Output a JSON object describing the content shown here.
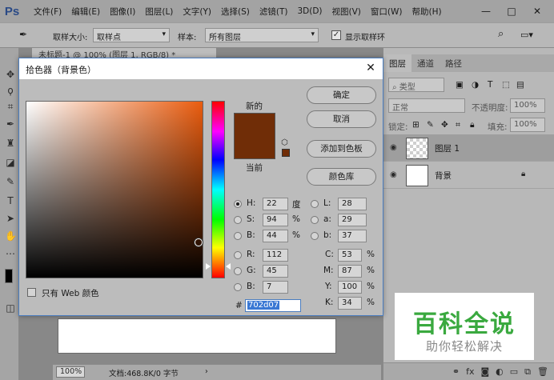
{
  "app": {
    "logo": "Ps",
    "menu": [
      "文件(F)",
      "编辑(E)",
      "图像(I)",
      "图层(L)",
      "文字(Y)",
      "选择(S)",
      "滤镜(T)",
      "3D(D)",
      "视图(V)",
      "窗口(W)",
      "帮助(H)"
    ],
    "window_controls": [
      "—",
      "□",
      "✕"
    ]
  },
  "options": {
    "sample_size_label": "取样大小:",
    "sample_size_value": "取样点",
    "sample_label": "样本:",
    "sample_value": "所有图层",
    "show_ring_label": "显示取样环",
    "show_ring_checked": true
  },
  "document": {
    "tab_title": "未标题-1 @ 100% (图层 1, RGB/8) *",
    "zoom": "100%",
    "info": "文档:468.8K/0 字节"
  },
  "layers_panel": {
    "tabs": [
      "图层",
      "通道",
      "路径"
    ],
    "filter_placeholder": "类型",
    "blend_mode": "正常",
    "opacity_label": "不透明度:",
    "opacity_value": "100%",
    "lock_label": "锁定:",
    "fill_label": "填充:",
    "fill_value": "100%",
    "layers": [
      {
        "name": "图层 1",
        "selected": true
      },
      {
        "name": "背景",
        "selected": false,
        "locked": true
      }
    ],
    "bottom_icons": [
      "link-icon",
      "fx-icon",
      "mask-icon",
      "adjustment-icon",
      "group-icon",
      "new-layer-icon",
      "trash-icon"
    ]
  },
  "watermark": {
    "line1": "百科全说",
    "line2": "助你轻松解决"
  },
  "color_picker": {
    "title": "拾色器（背景色）",
    "new_label": "新的",
    "current_label": "当前",
    "current_color": "#702d07",
    "buttons": {
      "ok": "确定",
      "cancel": "取消",
      "add_swatch": "添加到色板",
      "color_libraries": "颜色库"
    },
    "hsb": {
      "h": {
        "label": "H:",
        "value": "22",
        "unit": "度"
      },
      "s": {
        "label": "S:",
        "value": "94",
        "unit": "%"
      },
      "b": {
        "label": "B:",
        "value": "44",
        "unit": "%"
      }
    },
    "rgb": {
      "r": {
        "label": "R:",
        "value": "112"
      },
      "g": {
        "label": "G:",
        "value": "45"
      },
      "b": {
        "label": "B:",
        "value": "7"
      }
    },
    "lab": {
      "l": {
        "label": "L:",
        "value": "28"
      },
      "a": {
        "label": "a:",
        "value": "29"
      },
      "b": {
        "label": "b:",
        "value": "37"
      }
    },
    "cmyk": {
      "c": {
        "label": "C:",
        "value": "53",
        "unit": "%"
      },
      "m": {
        "label": "M:",
        "value": "87",
        "unit": "%"
      },
      "y": {
        "label": "Y:",
        "value": "100",
        "unit": "%"
      },
      "k": {
        "label": "K:",
        "value": "34",
        "unit": "%"
      }
    },
    "hex_label": "#",
    "hex_value": "702d07",
    "web_only_label": "只有 Web 颜色"
  }
}
